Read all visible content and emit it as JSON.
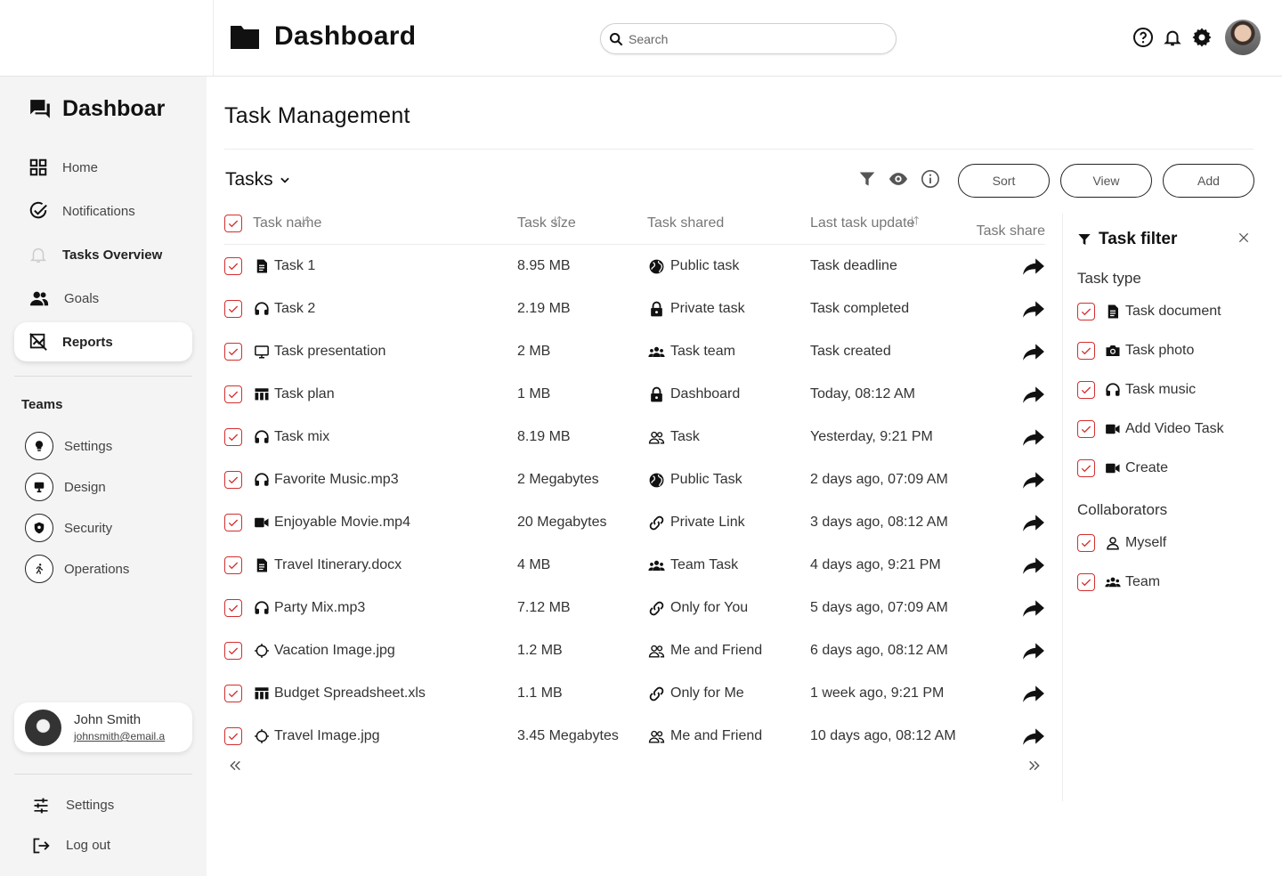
{
  "header": {
    "title": "Dashboard",
    "search_placeholder": "Search"
  },
  "sidebar": {
    "brand": "Dashboar",
    "nav": [
      {
        "label": "Home",
        "icon": "grid-icon"
      },
      {
        "label": "Notifications",
        "icon": "check-circle-icon"
      },
      {
        "label": "Tasks Overview",
        "icon": "bell-icon"
      },
      {
        "label": "Goals",
        "icon": "people-icon"
      },
      {
        "label": "Reports",
        "icon": "report-icon"
      }
    ],
    "teams_title": "Teams",
    "teams": [
      {
        "label": "Settings",
        "icon": "bulb-icon"
      },
      {
        "label": "Design",
        "icon": "monitor-icon"
      },
      {
        "label": "Security",
        "icon": "shield-icon"
      },
      {
        "label": "Operations",
        "icon": "run-icon"
      }
    ],
    "user": {
      "name": "John Smith",
      "email": "johnsmith@email.a"
    },
    "bottom": [
      {
        "label": "Settings",
        "icon": "sliders-icon"
      },
      {
        "label": "Log out",
        "icon": "logout-icon"
      }
    ]
  },
  "main": {
    "page_title": "Task Management",
    "tasks_label": "Tasks",
    "buttons": {
      "sort": "Sort",
      "view": "View",
      "add": "Add"
    },
    "columns": [
      "Task name",
      "Task size",
      "Task shared",
      "Last task update",
      "Task share"
    ],
    "rows": [
      {
        "name": "Task 1",
        "name_icon": "document-icon",
        "size": "8.95 MB",
        "shared": "Public task",
        "shared_icon": "globe-icon",
        "updated": "Task deadline"
      },
      {
        "name": "Task 2",
        "name_icon": "headphones-icon",
        "size": "2.19 MB",
        "shared": "Private task",
        "shared_icon": "lock-icon",
        "updated": "Task completed"
      },
      {
        "name": "Task presentation",
        "name_icon": "monitor-icon",
        "size": "2 MB",
        "shared": "Task team",
        "shared_icon": "group-icon",
        "updated": "Task created"
      },
      {
        "name": "Task plan",
        "name_icon": "table-icon",
        "size": "1 MB",
        "shared": "Dashboard",
        "shared_icon": "lock-icon",
        "updated": "Today, 08:12 AM"
      },
      {
        "name": "Task mix",
        "name_icon": "headphones-icon",
        "size": "8.19 MB",
        "shared": "Task",
        "shared_icon": "people-outline-icon",
        "updated": "Yesterday, 9:21 PM"
      },
      {
        "name": "Favorite Music.mp3",
        "name_icon": "headphones-icon",
        "size": "2 Megabytes",
        "shared": "Public Task",
        "shared_icon": "globe-icon",
        "updated": "2 days ago, 07:09 AM"
      },
      {
        "name": "Enjoyable Movie.mp4",
        "name_icon": "video-icon",
        "size": "20 Megabytes",
        "shared": "Private Link",
        "shared_icon": "link-icon",
        "updated": "3 days ago, 08:12 AM"
      },
      {
        "name": "Travel Itinerary.docx",
        "name_icon": "document-icon",
        "size": "4 MB",
        "shared": "Team Task",
        "shared_icon": "group-icon",
        "updated": "4 days ago, 9:21 PM"
      },
      {
        "name": "Party Mix.mp3",
        "name_icon": "headphones-icon",
        "size": "7.12 MB",
        "shared": "Only for You",
        "shared_icon": "link-icon",
        "updated": "5 days ago, 07:09 AM"
      },
      {
        "name": "Vacation Image.jpg",
        "name_icon": "aperture-icon",
        "size": "1.2 MB",
        "shared": "Me and Friend",
        "shared_icon": "people-outline-icon",
        "updated": "6 days ago, 08:12 AM"
      },
      {
        "name": "Budget Spreadsheet.xls",
        "name_icon": "table-icon",
        "size": "1.1 MB",
        "shared": "Only for Me",
        "shared_icon": "link-icon",
        "updated": "1 week ago, 9:21 PM"
      },
      {
        "name": "Travel Image.jpg",
        "name_icon": "aperture-icon",
        "size": "3.45 Megabytes",
        "shared": "Me and Friend",
        "shared_icon": "people-outline-icon",
        "updated": "10 days ago, 08:12 AM"
      }
    ]
  },
  "filter": {
    "title": "Task filter",
    "type_title": "Task type",
    "types": [
      {
        "label": "Task document",
        "icon": "document-icon"
      },
      {
        "label": "Task photo",
        "icon": "camera-icon"
      },
      {
        "label": "Task music",
        "icon": "headphones-icon"
      },
      {
        "label": "Add Video Task",
        "icon": "video-icon"
      },
      {
        "label": "Create",
        "icon": "video-icon"
      }
    ],
    "collab_title": "Collaborators",
    "collaborators": [
      {
        "label": "Myself",
        "icon": "person-icon"
      },
      {
        "label": "Team",
        "icon": "group-icon"
      }
    ]
  },
  "colors": {
    "checkbox": "#d32f2f",
    "sidebar_bg": "#f4f4f4"
  }
}
